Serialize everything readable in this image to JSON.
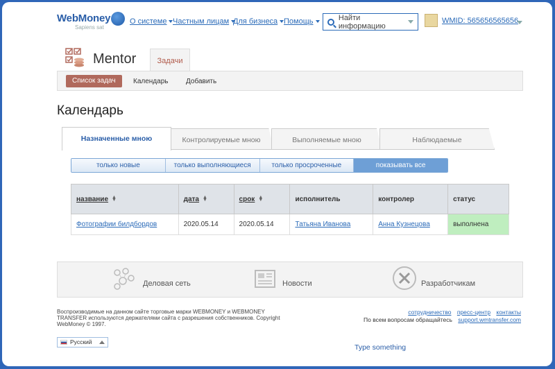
{
  "header": {
    "logo_text": "WebMoney",
    "logo_sub": "Sapiens sat",
    "nav": [
      {
        "label": "О системе"
      },
      {
        "label": "Частным лицам"
      },
      {
        "label": "Для бизнеса"
      },
      {
        "label": "Помощь"
      }
    ],
    "search_placeholder": "Найти информацию",
    "wmid": "WMID: 565656565656"
  },
  "mentor": {
    "title": "Mentor",
    "tab": "Задачи",
    "subnav": {
      "list": "Список задач",
      "calendar": "Календарь",
      "add": "Добавить"
    }
  },
  "page_title": "Календарь",
  "tabs": [
    "Назначенные мною",
    "Контролируемые мною",
    "Выполняемые мною",
    "Наблюдаемые"
  ],
  "filters": [
    "только новые",
    "только выполняющиеся",
    "только просроченные",
    "показывать все"
  ],
  "table": {
    "headers": {
      "name": "название",
      "date": "дата",
      "deadline": "срок",
      "executor": "исполнитель",
      "controller": "контролер",
      "status": "статус"
    },
    "rows": [
      {
        "name": "Фотографии билдбордов",
        "date": "2020.05.14",
        "deadline": "2020.05.14",
        "executor": "Татьяна Иванова",
        "controller": "Анна Кузнецова",
        "status": "выполнена"
      }
    ]
  },
  "footer": {
    "items": [
      "Деловая сеть",
      "Новости",
      "Разработчикам"
    ],
    "legal": "Воспроизводимые на данном сайте торговые марки WEBMONEY и WEBMONEY TRANSFER используются держателями сайта с разрешения собственников. Copyright WebMoney © 1997.",
    "links": [
      "сотрудничество",
      "пресс-центр",
      "контакты"
    ],
    "support_prefix": "По всем вопросам обращайтесь",
    "support_link": "support.wmtransfer.com",
    "language": "Русский",
    "type_something": "Type something"
  },
  "colors": {
    "accent": "#2a6ab8",
    "status_done": "#bfeebf",
    "active_btn": "#b0695c"
  }
}
